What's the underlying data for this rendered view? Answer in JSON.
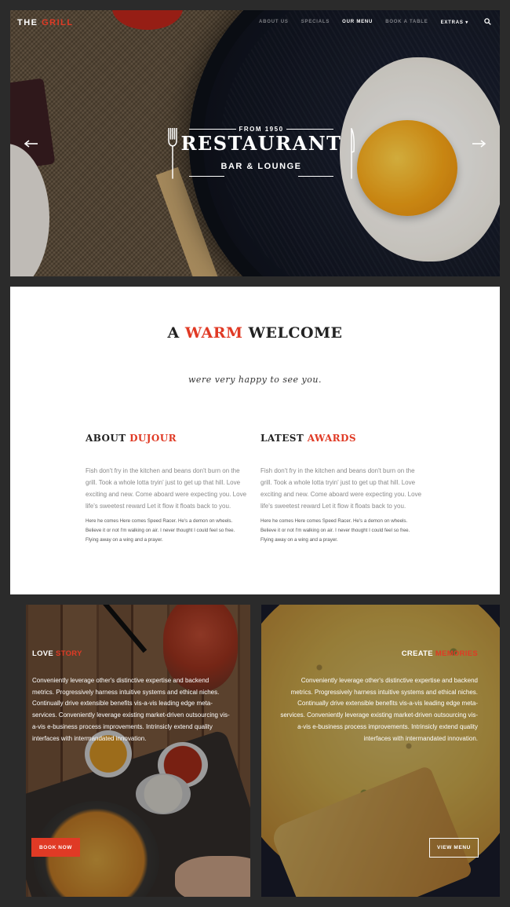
{
  "nav": {
    "logo_part1": "THE",
    "logo_part2": "GRILL",
    "items": [
      {
        "label": "ABOUT US"
      },
      {
        "label": "SPECIALS"
      },
      {
        "label": "OUR MENU"
      },
      {
        "label": "BOOK A TABLE"
      },
      {
        "label": "EXTRAS"
      }
    ],
    "extras_caret": "▾",
    "active_item": "OUR MENU",
    "search_icon": "search-icon"
  },
  "hero": {
    "from": "FROM 1950",
    "title": "RESTAURANT",
    "subtitle": "BAR & LOUNGE",
    "prev_icon": "arrow-left-icon",
    "next_icon": "arrow-right-icon"
  },
  "welcome": {
    "title_pre": "A",
    "title_accent": "WARM",
    "title_post": "WELCOME",
    "tagline": "were very happy to see you.",
    "columns": [
      {
        "heading_pre": "ABOUT",
        "heading_accent": "DUJOUR",
        "body": "Fish don't fry in the kitchen and beans don't burn on the grill. Took a whole lotta tryin' just to get up that hill. Love exciting and new. Come aboard were expecting you. Love life's sweetest reward Let it flow it floats back to you.",
        "small": "Here he comes Here comes Speed Racer. He's a demon on wheels. Believe it or not I'm walking on air. I never thought I could feel so free. Flying away on a wing and a prayer."
      },
      {
        "heading_pre": "LATEST",
        "heading_accent": "AWARDS",
        "body": "Fish don't fry in the kitchen and beans don't burn on the grill. Took a whole lotta tryin' just to get up that hill. Love exciting and new. Come aboard were expecting you. Love life's sweetest reward Let it flow it floats back to you.",
        "small": "Here he comes Here comes Speed Racer. He's a demon on wheels. Believe it or not I'm walking on air. I never thought I could feel so free. Flying away on a wing and a prayer."
      }
    ]
  },
  "cards": {
    "left": {
      "title_pre": "LOVE",
      "title_accent": "STORY",
      "body": "Conveniently leverage other's distinctive expertise and backend metrics. Progressively harness intuitive systems and ethical niches. Continually drive extensible benefits vis-a-vis leading edge meta-services. Conveniently leverage existing market-driven outsourcing vis-a-vis e-business process improvements. Intrinsicly extend quality interfaces with intermandated innovation.",
      "button": "BOOK NOW"
    },
    "right": {
      "title_pre": "CREATE",
      "title_accent": "MEMORIES",
      "body": "Conveniently leverage other's distinctive expertise and backend metrics. Progressively harness intuitive systems and ethical niches. Continually drive extensible benefits vis-a-vis leading edge meta-services. Conveniently leverage existing market-driven outsourcing vis-a-vis e-business process improvements. Intrinsicly extend quality interfaces with intermandated innovation.",
      "button": "VIEW MENU"
    }
  },
  "colors": {
    "accent": "#e03a25",
    "page_bg": "#2b2b2b",
    "panel_bg": "#ffffff"
  }
}
